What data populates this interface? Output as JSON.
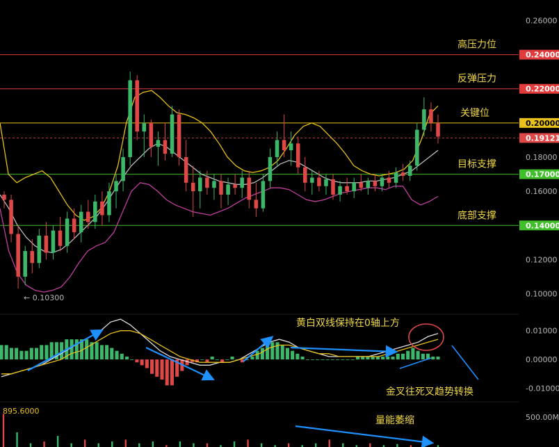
{
  "chart_data": {
    "type": "candlestick",
    "price_axis": {
      "ticks": [
        "0.26000",
        "0.18000",
        "0.16000",
        "0.12000",
        "0.10000"
      ],
      "range": [
        0.088,
        0.272
      ]
    },
    "low_marker": "← 0.10300",
    "levels": [
      {
        "price": 0.24,
        "label": "0.24000",
        "color": "#e23b3b",
        "annotation": "高压力位"
      },
      {
        "price": 0.22,
        "label": "0.22000",
        "color": "#e23b3b",
        "annotation": "反弹压力"
      },
      {
        "price": 0.2,
        "label": "0.20000",
        "color": "#e8c21a",
        "annotation": "关键位"
      },
      {
        "price": 0.17,
        "label": "0.17000",
        "color": "#3fbf2a",
        "annotation": "目标支撑"
      },
      {
        "price": 0.14,
        "label": "0.14000",
        "color": "#3fbf2a",
        "annotation": "底部支撑"
      }
    ],
    "current_price": {
      "price": 0.19121,
      "label": "0.19121",
      "color": "#e04848"
    },
    "candles": [
      [
        0.158,
        0.16,
        0.15,
        0.155
      ],
      [
        0.155,
        0.158,
        0.13,
        0.135
      ],
      [
        0.135,
        0.14,
        0.103,
        0.11
      ],
      [
        0.11,
        0.128,
        0.105,
        0.125
      ],
      [
        0.125,
        0.132,
        0.112,
        0.118
      ],
      [
        0.118,
        0.138,
        0.115,
        0.134
      ],
      [
        0.134,
        0.142,
        0.12,
        0.124
      ],
      [
        0.124,
        0.14,
        0.12,
        0.137
      ],
      [
        0.137,
        0.145,
        0.125,
        0.128
      ],
      [
        0.128,
        0.148,
        0.124,
        0.144
      ],
      [
        0.144,
        0.15,
        0.132,
        0.136
      ],
      [
        0.136,
        0.152,
        0.13,
        0.148
      ],
      [
        0.148,
        0.155,
        0.138,
        0.142
      ],
      [
        0.142,
        0.158,
        0.138,
        0.154
      ],
      [
        0.154,
        0.16,
        0.14,
        0.146
      ],
      [
        0.146,
        0.165,
        0.142,
        0.16
      ],
      [
        0.16,
        0.17,
        0.15,
        0.166
      ],
      [
        0.166,
        0.185,
        0.16,
        0.18
      ],
      [
        0.18,
        0.23,
        0.175,
        0.225
      ],
      [
        0.225,
        0.228,
        0.19,
        0.195
      ],
      [
        0.195,
        0.205,
        0.18,
        0.2
      ],
      [
        0.2,
        0.202,
        0.18,
        0.186
      ],
      [
        0.186,
        0.195,
        0.175,
        0.19
      ],
      [
        0.19,
        0.2,
        0.178,
        0.182
      ],
      [
        0.182,
        0.21,
        0.18,
        0.205
      ],
      [
        0.205,
        0.208,
        0.175,
        0.18
      ],
      [
        0.18,
        0.19,
        0.16,
        0.165
      ],
      [
        0.165,
        0.175,
        0.145,
        0.16
      ],
      [
        0.16,
        0.172,
        0.15,
        0.168
      ],
      [
        0.168,
        0.172,
        0.158,
        0.162
      ],
      [
        0.162,
        0.17,
        0.155,
        0.166
      ],
      [
        0.166,
        0.17,
        0.15,
        0.158
      ],
      [
        0.158,
        0.168,
        0.152,
        0.164
      ],
      [
        0.164,
        0.17,
        0.158,
        0.162
      ],
      [
        0.162,
        0.172,
        0.156,
        0.168
      ],
      [
        0.168,
        0.172,
        0.15,
        0.155
      ],
      [
        0.155,
        0.165,
        0.145,
        0.15
      ],
      [
        0.15,
        0.17,
        0.148,
        0.166
      ],
      [
        0.166,
        0.185,
        0.162,
        0.18
      ],
      [
        0.18,
        0.195,
        0.175,
        0.19
      ],
      [
        0.19,
        0.205,
        0.18,
        0.184
      ],
      [
        0.184,
        0.195,
        0.175,
        0.188
      ],
      [
        0.188,
        0.192,
        0.17,
        0.174
      ],
      [
        0.174,
        0.18,
        0.16,
        0.165
      ],
      [
        0.165,
        0.172,
        0.158,
        0.168
      ],
      [
        0.168,
        0.172,
        0.16,
        0.163
      ],
      [
        0.163,
        0.17,
        0.158,
        0.167
      ],
      [
        0.167,
        0.17,
        0.155,
        0.158
      ],
      [
        0.158,
        0.166,
        0.154,
        0.163
      ],
      [
        0.163,
        0.168,
        0.158,
        0.16
      ],
      [
        0.16,
        0.168,
        0.156,
        0.165
      ],
      [
        0.165,
        0.17,
        0.16,
        0.162
      ],
      [
        0.162,
        0.168,
        0.158,
        0.166
      ],
      [
        0.166,
        0.17,
        0.16,
        0.163
      ],
      [
        0.163,
        0.17,
        0.16,
        0.168
      ],
      [
        0.168,
        0.172,
        0.162,
        0.165
      ],
      [
        0.165,
        0.174,
        0.162,
        0.171
      ],
      [
        0.171,
        0.176,
        0.166,
        0.169
      ],
      [
        0.169,
        0.178,
        0.166,
        0.175
      ],
      [
        0.175,
        0.2,
        0.172,
        0.196
      ],
      [
        0.196,
        0.215,
        0.192,
        0.208
      ],
      [
        0.208,
        0.212,
        0.195,
        0.2
      ],
      [
        0.2,
        0.205,
        0.188,
        0.192
      ]
    ],
    "bollinger": {
      "upper": [
        0.2,
        0.17,
        0.165,
        0.168,
        0.17,
        0.172,
        0.168,
        0.16,
        0.152,
        0.146,
        0.143,
        0.145,
        0.15,
        0.16,
        0.175,
        0.2,
        0.215,
        0.218,
        0.219,
        0.215,
        0.21,
        0.206,
        0.205,
        0.203,
        0.2,
        0.195,
        0.188,
        0.18,
        0.175,
        0.172,
        0.171,
        0.172,
        0.174,
        0.178,
        0.185,
        0.193,
        0.198,
        0.2,
        0.198,
        0.193,
        0.188,
        0.182,
        0.175,
        0.172,
        0.17,
        0.169,
        0.17,
        0.171,
        0.173,
        0.178,
        0.19,
        0.205,
        0.21
      ],
      "middle": [
        0.158,
        0.15,
        0.14,
        0.133,
        0.128,
        0.125,
        0.124,
        0.126,
        0.13,
        0.135,
        0.14,
        0.145,
        0.152,
        0.16,
        0.168,
        0.175,
        0.18,
        0.185,
        0.188,
        0.186,
        0.182,
        0.178,
        0.174,
        0.17,
        0.168,
        0.166,
        0.165,
        0.164,
        0.164,
        0.165,
        0.168,
        0.172,
        0.176,
        0.178,
        0.177,
        0.174,
        0.171,
        0.168,
        0.166,
        0.165,
        0.165,
        0.165,
        0.166,
        0.166,
        0.167,
        0.168,
        0.17,
        0.172,
        0.176,
        0.18,
        0.184
      ],
      "lower": [
        0.15,
        0.125,
        0.112,
        0.105,
        0.102,
        0.101,
        0.102,
        0.104,
        0.11,
        0.118,
        0.125,
        0.128,
        0.13,
        0.136,
        0.148,
        0.16,
        0.165,
        0.164,
        0.16,
        0.155,
        0.152,
        0.15,
        0.148,
        0.147,
        0.146,
        0.148,
        0.15,
        0.153,
        0.156,
        0.158,
        0.16,
        0.162,
        0.162,
        0.161,
        0.158,
        0.155,
        0.154,
        0.155,
        0.157,
        0.159,
        0.16,
        0.161,
        0.162,
        0.162,
        0.161,
        0.163,
        0.163,
        0.155,
        0.152,
        0.154,
        0.157
      ]
    },
    "macd": {
      "ticks": [
        "0.01000",
        "0.00000",
        "-0.01000"
      ],
      "range": [
        -0.014,
        0.015
      ],
      "hist": [
        0.005,
        0.005,
        0.004,
        0.004,
        0.003,
        0.003,
        0.004,
        0.004,
        0.005,
        0.005,
        0.006,
        0.006,
        0.006,
        0.007,
        0.007,
        0.007,
        0.007,
        0.007,
        0.006,
        0.006,
        0.005,
        0.005,
        0.004,
        0.003,
        0.002,
        0.001,
        0.0,
        -0.001,
        -0.002,
        -0.003,
        -0.005,
        -0.006,
        -0.007,
        -0.009,
        -0.009,
        -0.006,
        -0.004,
        -0.002,
        -0.001,
        -0.001,
        0.0,
        -0.001,
        0.001,
        0.0,
        -0.001,
        0.0,
        0.001,
        0.0,
        -0.001,
        0.0,
        0.001,
        0.003,
        0.004,
        0.005,
        0.006,
        0.006,
        0.005,
        0.004,
        0.003,
        0.002,
        0.001,
        0.0,
        0.0,
        0.0,
        0.0,
        0.0,
        0.0,
        0.0,
        0.0,
        0.0,
        0.0,
        0.001,
        0.001,
        0.001,
        0.001,
        0.001,
        0.001,
        0.001,
        0.001,
        0.002,
        0.002,
        0.003,
        0.004,
        0.003,
        0.002,
        0.002,
        0.001,
        0.001
      ],
      "dif": [
        -0.006,
        -0.005,
        -0.004,
        -0.003,
        -0.002,
        0.0,
        0.002,
        0.004,
        0.006,
        0.008,
        0.01,
        0.013,
        0.014,
        0.012,
        0.009,
        0.006,
        0.003,
        0.001,
        0.0,
        -0.001,
        -0.002,
        -0.002,
        -0.001,
        -0.001,
        0.0,
        0.002,
        0.004,
        0.006,
        0.007,
        0.006,
        0.004,
        0.003,
        0.002,
        0.001,
        0.001,
        0.001,
        0.001,
        0.001,
        0.002,
        0.003,
        0.004,
        0.005,
        0.006,
        0.008,
        0.009
      ],
      "dea": [
        -0.005,
        -0.005,
        -0.004,
        -0.003,
        -0.002,
        -0.001,
        0.0,
        0.002,
        0.003,
        0.005,
        0.007,
        0.009,
        0.01,
        0.01,
        0.009,
        0.007,
        0.005,
        0.003,
        0.001,
        0.0,
        -0.001,
        -0.001,
        -0.001,
        -0.001,
        0.0,
        0.001,
        0.002,
        0.004,
        0.005,
        0.005,
        0.004,
        0.003,
        0.002,
        0.002,
        0.001,
        0.001,
        0.001,
        0.001,
        0.001,
        0.002,
        0.003,
        0.004,
        0.005,
        0.006,
        0.007
      ]
    },
    "volume": {
      "max_label": "895.6000",
      "tick": "500.00M",
      "values": [
        0.9,
        0.4,
        0.1,
        0.15,
        0.3,
        0.1,
        0.2,
        0.1,
        0.15,
        0.2,
        0.1,
        0.15,
        0.05,
        0.15,
        0.1,
        0.1,
        0.05,
        0.15,
        0.2,
        0.1,
        0.05,
        0.1,
        0.05,
        0.1,
        0.2,
        0.1,
        0.05,
        0.1,
        0.05,
        0.08,
        0.05,
        0.1,
        0.05
      ]
    },
    "annotations": {
      "macd_note": "黄白双线保持在0轴上方",
      "cross_note": "金叉往死叉趋势转换",
      "volume_note": "量能萎缩"
    }
  },
  "colors": {
    "up": "#3db86b",
    "down": "#e04848",
    "bb_upper": "#e8c21a",
    "bb_middle": "#bdbdbd",
    "bb_lower": "#c040a0",
    "arrow": "#1e90ff",
    "circle": "#e04848"
  }
}
